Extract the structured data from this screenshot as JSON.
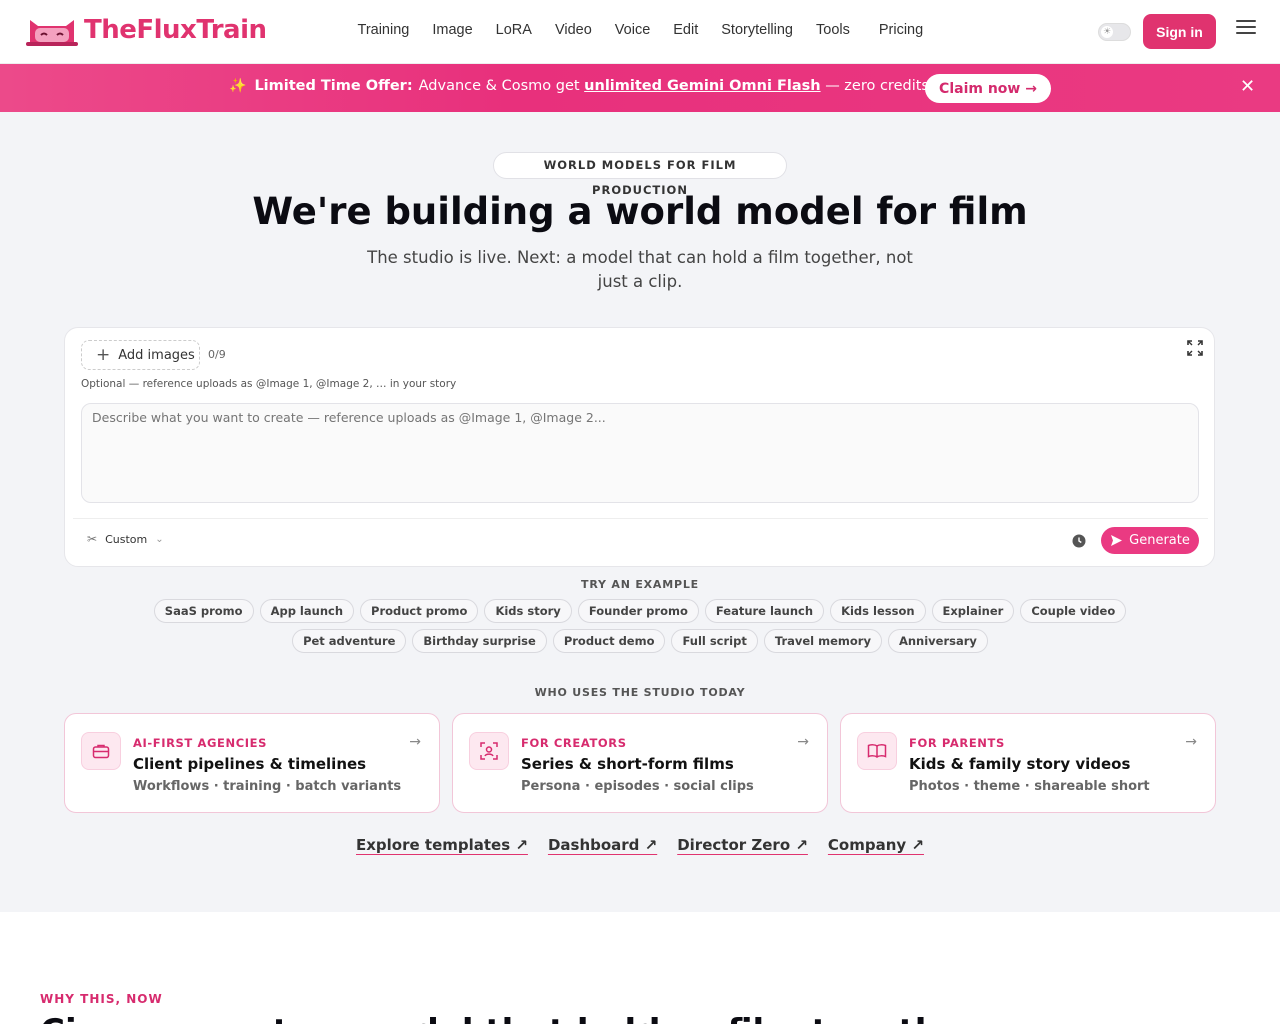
{
  "header": {
    "brand": "TheFluxTrain",
    "nav": [
      "Training",
      "Image",
      "LoRA",
      "Video",
      "Voice",
      "Edit",
      "Storytelling",
      "Tools",
      "Pricing"
    ],
    "signin_label": "Sign in"
  },
  "banner": {
    "lead": "Limited Time Offer:",
    "text_before": "Advance & Cosmo get",
    "highlight": "unlimited Gemini Omni Flash",
    "text_after": "— zero credits!",
    "cta": "Claim now →"
  },
  "hero": {
    "eyebrow": "WORLD MODELS FOR FILM PRODUCTION",
    "title": "We're building a world model for film",
    "subtitle": "The studio is live. Next: a model that can hold a film together, not just a clip."
  },
  "composer": {
    "add_images_label": "Add images",
    "image_count": "0/9",
    "hint": "Optional — reference uploads as @Image 1, @Image 2, … in your story",
    "prompt_placeholder": "Describe what you want to create — reference uploads as @Image 1, @Image 2...",
    "style_label": "Custom",
    "generate_label": "Generate"
  },
  "examples": {
    "label": "TRY AN EXAMPLE",
    "row1": [
      "SaaS promo",
      "App launch",
      "Product promo",
      "Kids story",
      "Founder promo",
      "Feature launch",
      "Kids lesson",
      "Explainer",
      "Couple video"
    ],
    "row2": [
      "Pet adventure",
      "Birthday surprise",
      "Product demo",
      "Full script",
      "Travel memory",
      "Anniversary"
    ]
  },
  "audience": {
    "label": "WHO USES THE STUDIO TODAY",
    "cards": [
      {
        "eyebrow": "AI-FIRST AGENCIES",
        "title": "Client pipelines & timelines",
        "sub": "Workflows · training · batch variants",
        "icon": "briefcase-icon"
      },
      {
        "eyebrow": "FOR CREATORS",
        "title": "Series & short-form films",
        "sub": "Persona · episodes · social clips",
        "icon": "user-focus-icon"
      },
      {
        "eyebrow": "FOR PARENTS",
        "title": "Kids & family story videos",
        "sub": "Photos · theme · shareable short",
        "icon": "book-icon"
      }
    ]
  },
  "links": [
    "Explore templates ↗",
    "Dashboard ↗",
    "Director Zero ↗",
    "Company ↗"
  ],
  "lower": {
    "eyebrow": "WHY THIS, NOW",
    "title": "Cinema wants a model that holds a film together"
  },
  "colors": {
    "brand": "#e0336f",
    "banner": "#e8307c",
    "accent_bg": "#fde8f0"
  }
}
